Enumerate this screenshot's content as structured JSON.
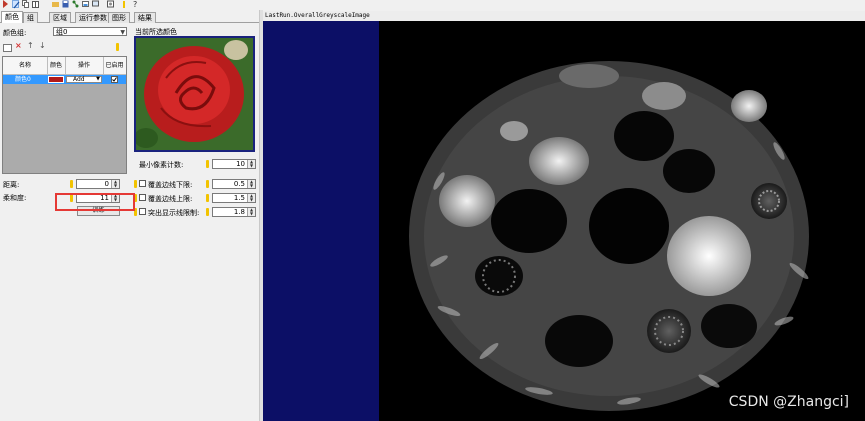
{
  "tabs": [
    {
      "label": "颜色",
      "active": true
    },
    {
      "label": "组",
      "active": false
    },
    {
      "label": "区域",
      "active": false
    },
    {
      "label": "运行参数",
      "active": false
    },
    {
      "label": "图形",
      "active": false
    },
    {
      "label": "结果",
      "active": false
    }
  ],
  "color_group": {
    "label": "颜色组:",
    "value": "组0"
  },
  "preview": {
    "label": "当前所选颜色"
  },
  "color_table": {
    "headers": [
      "名称",
      "颜色",
      "操作",
      "已启用"
    ],
    "rows": [
      {
        "name": "颜色0",
        "action": "Add",
        "color": "#b01a1a",
        "enabled": true
      }
    ]
  },
  "params_left": [
    {
      "label": "距离:",
      "value": "0"
    },
    {
      "label": "柔和度:",
      "value": "11"
    }
  ],
  "small_button": "训练",
  "params_right": [
    {
      "label": "最小像素计数:",
      "value": "10",
      "checkbox": false
    },
    {
      "label": "覆盖边线下限:",
      "value": "0.5",
      "checkbox": true
    },
    {
      "label": "覆盖边线上限:",
      "value": "1.5",
      "checkbox": false
    },
    {
      "label": "突出显示线限制:",
      "value": "1.8",
      "checkbox": true
    }
  ],
  "viewer": {
    "title": "LastRun.OverallGreyscaleImage"
  },
  "watermark": "CSDN @Zhangci]",
  "colors": {
    "accent": "#3399ff",
    "highlight": "#e53935",
    "navy": "#0c0f66",
    "swatch": "#b01a1a"
  }
}
